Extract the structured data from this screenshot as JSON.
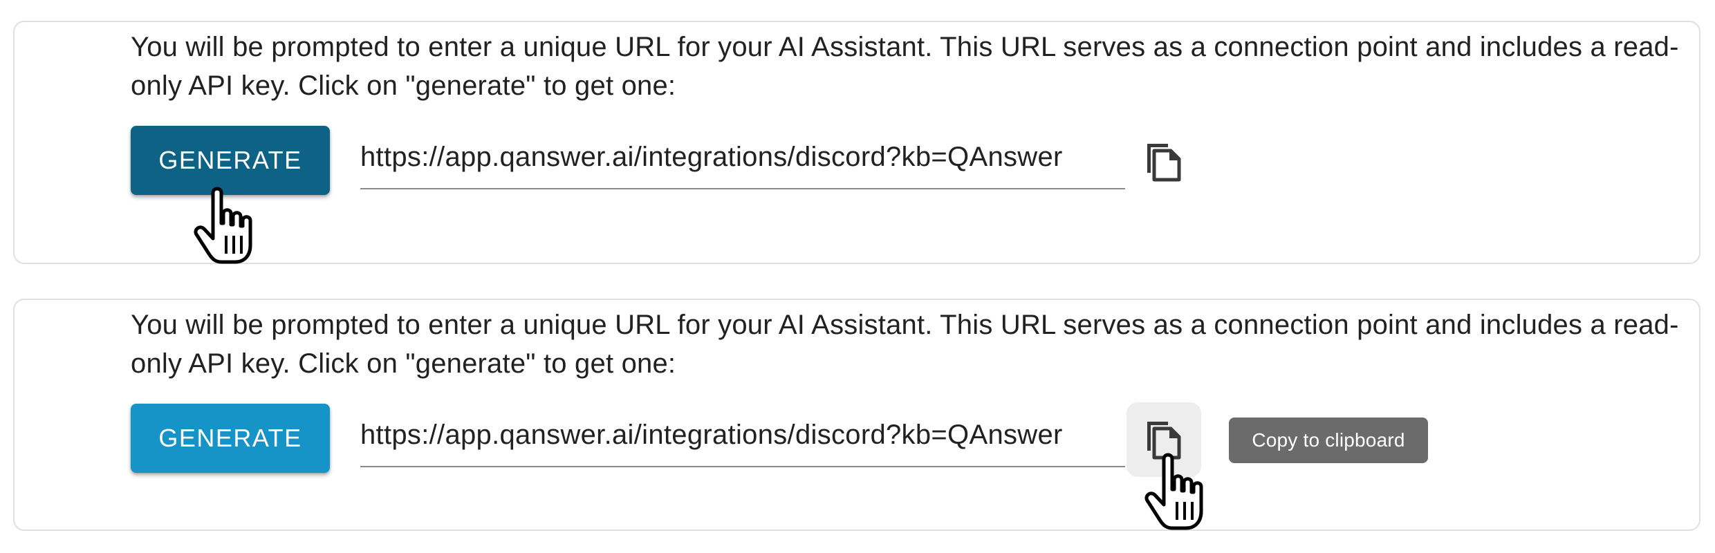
{
  "panels": [
    {
      "description": "You will be prompted to enter a unique URL for your AI Assistant. This URL serves as a connection point and includes a read-only API key. Click on \"generate\" to get one:",
      "generate_label": "GENERATE",
      "url_value": "https://app.qanswer.ai/integrations/discord?kb=QAnswer",
      "copy_icon": "content-copy-icon",
      "cursor_icon": "hand-pointer-icon",
      "state": "generate button pressed"
    },
    {
      "description": "You will be prompted to enter a unique URL for your AI Assistant. This URL serves as a connection point and includes a read-only API key. Click on \"generate\" to get one:",
      "generate_label": "GENERATE",
      "url_value": "https://app.qanswer.ai/integrations/discord?kb=QAnswer",
      "copy_icon": "content-copy-icon",
      "cursor_icon": "hand-pointer-icon",
      "tooltip": "Copy to clipboard",
      "state": "copy button hovered"
    }
  ],
  "colors": {
    "generate_pressed": "#0e6286",
    "generate_normal": "#1693c7",
    "tooltip_bg": "#6b6b6b",
    "text": "#212121"
  }
}
